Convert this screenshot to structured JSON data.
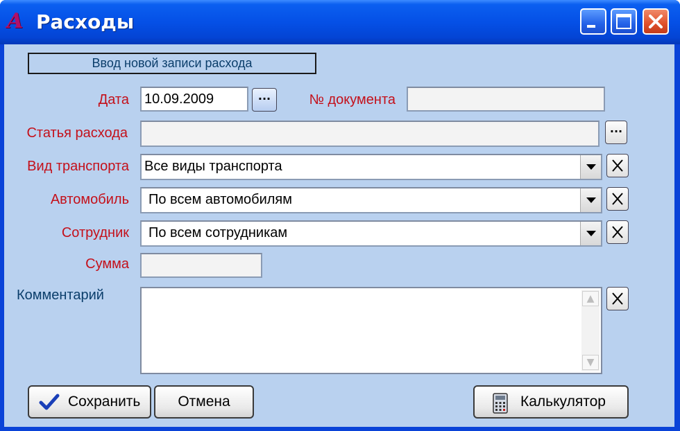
{
  "window": {
    "title": "Расходы",
    "icon": "app-logo-icon",
    "logo_letter": "A"
  },
  "titlebar_buttons": [
    "minimize-icon",
    "maximize-icon",
    "close-icon"
  ],
  "form": {
    "banner": "Ввод новой записи расхода",
    "date": {
      "label": "Дата",
      "value": "10.09.2009",
      "button": "..."
    },
    "doc_number": {
      "label": "№ документа",
      "value": ""
    },
    "expense_item": {
      "label": "Статья расхода",
      "value": "",
      "button": "..."
    },
    "transport_type": {
      "label": "Вид транспорта",
      "value": "Все виды транспорта"
    },
    "car": {
      "label": "Автомобиль",
      "value": "По всем автомобилям"
    },
    "employee": {
      "label": "Сотрудник",
      "value": "По всем сотрудникам"
    },
    "sum": {
      "label": "Сумма",
      "value": ""
    },
    "comment": {
      "label": "Комментарий",
      "value": ""
    }
  },
  "buttons": {
    "save": "Сохранить",
    "cancel": "Отмена",
    "calculator": "Калькулятор"
  },
  "colors": {
    "title_bar": "#0550e6",
    "dialog_bg": "#b9d1ef",
    "label_red": "#c4101a",
    "label_blue": "#0b3e6b"
  }
}
